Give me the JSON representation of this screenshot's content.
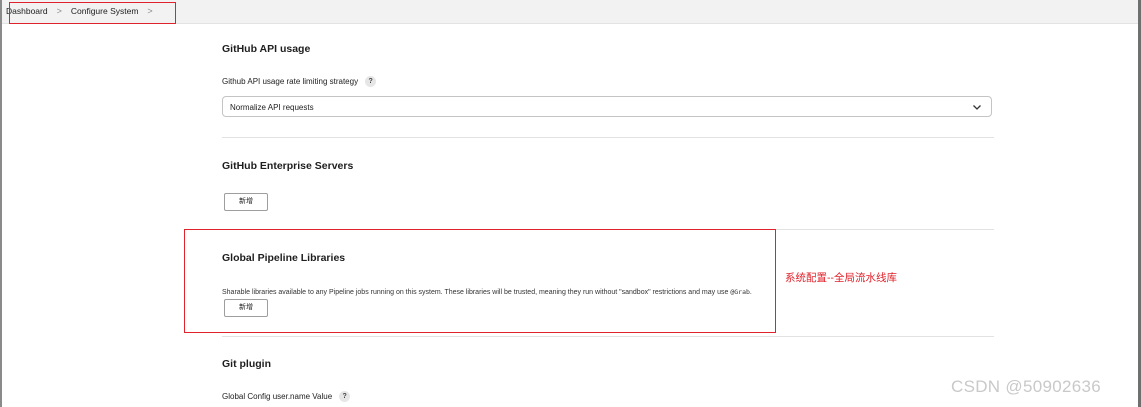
{
  "breadcrumb": {
    "items": [
      "Dashboard",
      "Configure System"
    ],
    "separator": ">"
  },
  "github_api": {
    "title": "GitHub API usage",
    "field_label": "Github API usage rate limiting strategy",
    "help": "?",
    "select_value": "Normalize API requests"
  },
  "enterprise": {
    "title": "GitHub Enterprise Servers",
    "add_button": "新增"
  },
  "pipeline_libs": {
    "title": "Global Pipeline Libraries",
    "description": "Sharable libraries available to any Pipeline jobs running on this system. These libraries will be trusted, meaning they run without \"sandbox\" restrictions and may use ",
    "code": "@Grab",
    "description_end": ".",
    "add_button": "新增"
  },
  "annotation": "系统配置--全局流水线库",
  "git_plugin": {
    "title": "Git plugin",
    "field_label": "Global Config user.name Value",
    "help": "?"
  },
  "watermark": "CSDN @50902636",
  "colors": {
    "highlight_red": "#e0222b",
    "topbar_bg": "#f2f2f2",
    "watermark": "#c9c9c9"
  }
}
